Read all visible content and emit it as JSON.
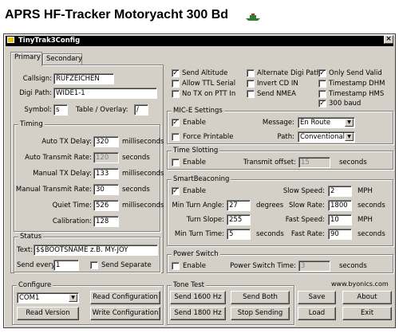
{
  "heading": "APRS HF-Tracker Motoryacht 300 Bd",
  "window": {
    "title": "TinyTrak3Config",
    "close": "×"
  },
  "tabs": [
    {
      "label": "Primary"
    },
    {
      "label": "Secondary"
    }
  ],
  "callsign": {
    "label": "Callsign:",
    "value": "RUFZEICHEN"
  },
  "digipath": {
    "label": "Digi Path:",
    "value": "WIDE1-1"
  },
  "symbol": {
    "label": "Symbol:",
    "value": "s",
    "table_label": "Table / Overlay:",
    "table_value": "/"
  },
  "timing": {
    "title": "Timing",
    "rows": [
      {
        "label": "Auto TX Delay:",
        "value": "320",
        "unit": "milliseconds",
        "disabled": false
      },
      {
        "label": "Auto Transmit Rate:",
        "value": "120",
        "unit": "seconds",
        "disabled": true
      },
      {
        "label": "Manual TX Delay:",
        "value": "133",
        "unit": "milliseconds",
        "disabled": false
      },
      {
        "label": "Manual Transmit Rate:",
        "value": "30",
        "unit": "seconds",
        "disabled": false
      },
      {
        "label": "Quiet Time:",
        "value": "526",
        "unit": "milliseconds",
        "disabled": false
      },
      {
        "label": "Calibration:",
        "value": "128",
        "unit": "",
        "disabled": false
      }
    ]
  },
  "status": {
    "title": "Status",
    "text_label": "Text:",
    "text_value": "$$BOOTSNAME z.B. MY-JOY",
    "every_label": "Send every:",
    "every_value": "1",
    "separate_label": "Send Separate",
    "separate_checked": false
  },
  "options": [
    {
      "label": "Send Altitude",
      "checked": true
    },
    {
      "label": "Alternate Digi Paths",
      "checked": false
    },
    {
      "label": "Only Send Valid",
      "checked": true
    },
    {
      "label": "Allow TTL Serial",
      "checked": false
    },
    {
      "label": "Invert CD IN",
      "checked": false
    },
    {
      "label": "Timestamp DHM",
      "checked": false
    },
    {
      "label": "No TX on PTT In",
      "checked": false
    },
    {
      "label": "Send NMEA",
      "checked": false
    },
    {
      "label": "Timestamp HMS",
      "checked": false
    },
    {
      "label": "300 baud",
      "checked": true
    }
  ],
  "mice": {
    "title": "MIC-E Settings",
    "enable_label": "Enable",
    "enable_checked": true,
    "force_label": "Force Printable",
    "force_checked": false,
    "message_label": "Message:",
    "message_value": "En Route",
    "path_label": "Path:",
    "path_value": "Conventional"
  },
  "timeslot": {
    "title": "Time Slotting",
    "enable_label": "Enable",
    "enable_checked": false,
    "offset_label": "Transmit offset:",
    "offset_value": "15",
    "unit": "seconds"
  },
  "smartbeacon": {
    "title": "SmartBeaconing",
    "enable_label": "Enable",
    "enable_checked": true,
    "slow_speed_label": "Slow Speed:",
    "slow_speed_value": "2",
    "slow_speed_unit": "MPH",
    "min_turn_angle_label": "Min Turn Angle:",
    "min_turn_angle_value": "27",
    "min_turn_angle_unit": "degrees",
    "slow_rate_label": "Slow Rate:",
    "slow_rate_value": "1800",
    "slow_rate_unit": "seconds",
    "turn_slope_label": "Turn Slope:",
    "turn_slope_value": "255",
    "fast_speed_label": "Fast Speed:",
    "fast_speed_value": "10",
    "fast_speed_unit": "MPH",
    "min_turn_time_label": "Min Turn Time:",
    "min_turn_time_value": "5",
    "min_turn_time_unit": "seconds",
    "fast_rate_label": "Fast Rate:",
    "fast_rate_value": "90",
    "fast_rate_unit": "seconds"
  },
  "powerswitch": {
    "title": "Power Switch",
    "enable_label": "Enable",
    "enable_checked": false,
    "time_label": "Power Switch Time:",
    "time_value": "3",
    "unit": "seconds"
  },
  "configure": {
    "title": "Configure",
    "port_value": "COM1",
    "read_config": "Read Configuration",
    "read_version": "Read Version",
    "write_config": "Write Configuration"
  },
  "tonetest": {
    "title": "Tone Test",
    "send1600": "Send 1600 Hz",
    "send_both": "Send Both",
    "send1800": "Send 1800 Hz",
    "stop": "Stop Sending"
  },
  "url": "www.byonics.com",
  "buttons": {
    "save": "Save",
    "about": "About",
    "load": "Load",
    "exit": "Exit"
  }
}
